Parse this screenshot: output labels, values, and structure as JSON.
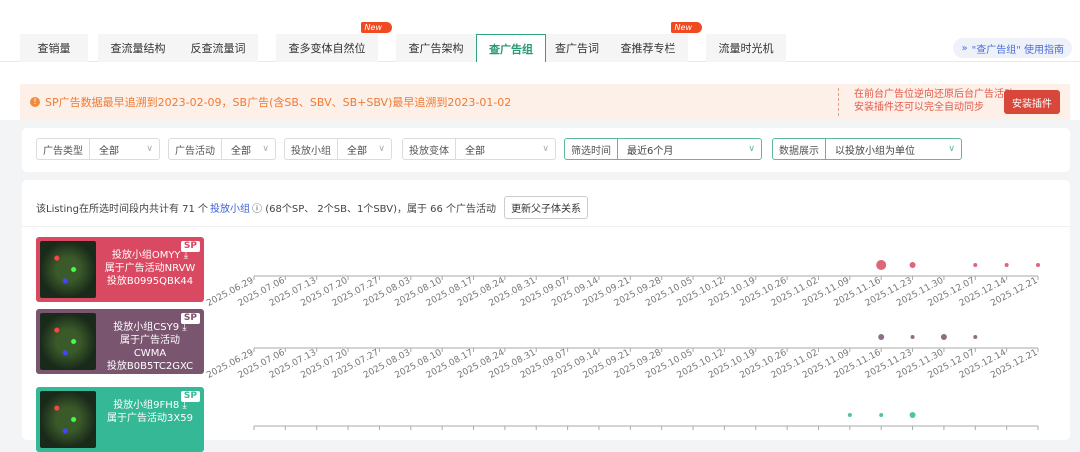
{
  "tabs": [
    {
      "label": "查销量",
      "w": 68,
      "gap": 10
    },
    {
      "label": "查流量结构",
      "w": 80,
      "gap": 0
    },
    {
      "label": "反查流量词",
      "w": 80,
      "gap": 18
    },
    {
      "label": "查多变体自然位",
      "w": 102,
      "gap": 18,
      "badge": "New"
    },
    {
      "label": "查广告架构",
      "w": 80,
      "gap": 0
    },
    {
      "label": "查广告组",
      "w": 70,
      "gap": 0,
      "active": true
    },
    {
      "label": "查广告词",
      "w": 62,
      "gap": 0
    },
    {
      "label": "查推荐专栏",
      "w": 80,
      "gap": 18,
      "badge": "New"
    },
    {
      "label": "流量时光机",
      "w": 80,
      "gap": 0
    }
  ],
  "guide": {
    "label": "\"查广告组\" 使用指南",
    "icon": "chevron-double-down-icon"
  },
  "notice": {
    "message": "SP广告数据最早追溯到2023-02-09，SB广告(含SB、SBV、SB+SBV)最早追溯到2023-01-02",
    "right_line1": "在前台广告位逆向还原后台广告活动",
    "right_line2": "安装插件还可以完全自动同步",
    "install_label": "安装插件"
  },
  "filters": [
    {
      "label": "广告类型",
      "value": "全部"
    },
    {
      "label": "广告活动",
      "value": "全部"
    },
    {
      "label": "投放小组",
      "value": "全部"
    },
    {
      "label": "投放变体",
      "value": "全部"
    },
    {
      "label": "筛选时间",
      "value": "最近6个月"
    },
    {
      "label": "数据展示",
      "value": "以投放小组为单位"
    }
  ],
  "summary": {
    "prefix": "该Listing在所选时间段内共计有 71 个",
    "link": "投放小组",
    "help_icon": "question-circle-icon",
    "suffix": "(68个SP、 2个SB、1个SBV)，属于 66 个广告活动",
    "update_label": "更新父子体关系"
  },
  "chart_data": {
    "type": "scatter",
    "x_ticks": [
      "2025.06.29",
      "2025.07.06",
      "2025.07.13",
      "2025.07.20",
      "2025.07.27",
      "2025.08.03",
      "2025.08.10",
      "2025.08.17",
      "2025.08.24",
      "2025.08.31",
      "2025.09.07",
      "2025.09.14",
      "2025.09.21",
      "2025.09.28",
      "2025.10.05",
      "2025.10.12",
      "2025.10.19",
      "2025.10.26",
      "2025.11.02",
      "2025.11.09",
      "2025.11.16",
      "2025.11.23",
      "2025.11.30",
      "2025.12.07",
      "2025.12.14",
      "2025.12.21"
    ],
    "rows": [
      {
        "color": "#d94a62",
        "badge": "SP",
        "line1": "投放小组OMYY",
        "line2": "属于广告活动NRVW",
        "line3": "投放B0995QBK44",
        "points": [
          {
            "x": "2025.11.16",
            "size": 3
          },
          {
            "x": "2025.11.23",
            "size": 2
          },
          {
            "x": "2025.12.07",
            "size": 1
          },
          {
            "x": "2025.12.14",
            "size": 1
          },
          {
            "x": "2025.12.21",
            "size": 1
          }
        ]
      },
      {
        "color": "#7a5570",
        "badge": "SP",
        "line1": "投放小组CSY9",
        "line2": "属于广告活动",
        "line3": "CWMA",
        "line4": "投放B0B5TC2GXC",
        "points": [
          {
            "x": "2025.11.16",
            "size": 2
          },
          {
            "x": "2025.11.23",
            "size": 1
          },
          {
            "x": "2025.11.30",
            "size": 2
          },
          {
            "x": "2025.12.07",
            "size": 1
          }
        ]
      },
      {
        "color": "#34b896",
        "badge": "SP",
        "line1": "投放小组9FH8",
        "line2": "属于广告活动3X59",
        "points": [
          {
            "x": "2025.11.09",
            "size": 1
          },
          {
            "x": "2025.11.16",
            "size": 1
          },
          {
            "x": "2025.11.23",
            "size": 2
          }
        ]
      }
    ]
  }
}
